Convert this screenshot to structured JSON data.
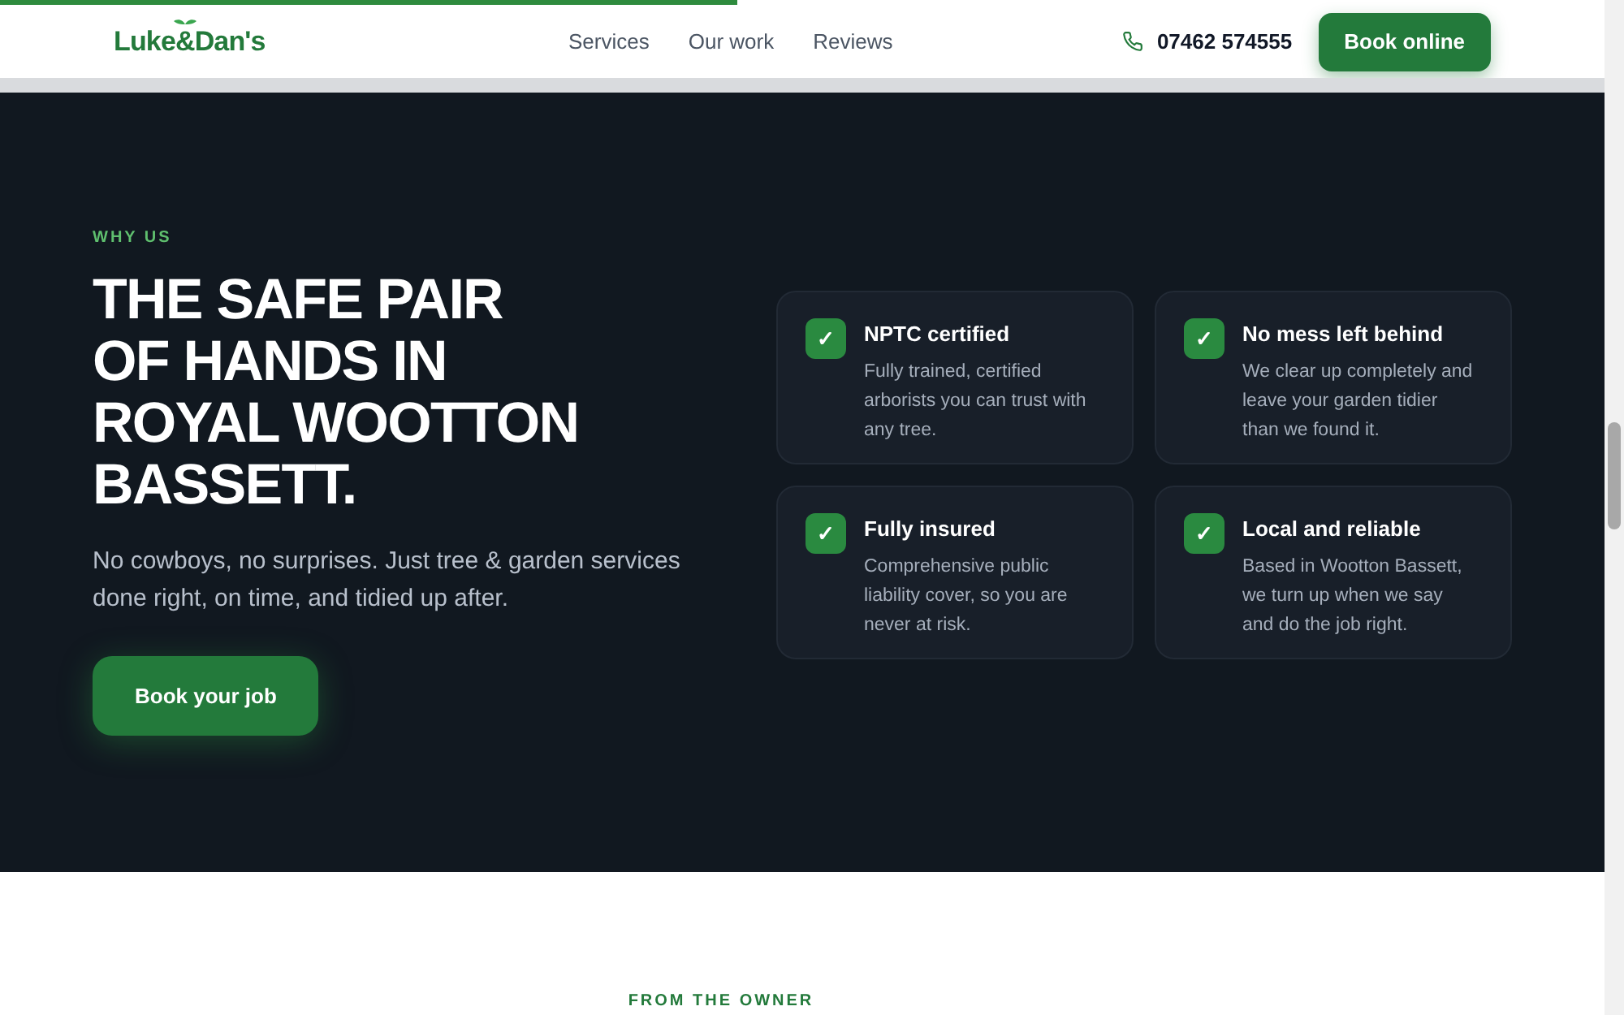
{
  "progress": {
    "level": 0.46
  },
  "header": {
    "logo": "Luke&Dan's",
    "nav": [
      {
        "label": "Services"
      },
      {
        "label": "Our work"
      },
      {
        "label": "Reviews"
      }
    ],
    "phone": "07462 574555",
    "cta": "Book online"
  },
  "hero": {
    "eyebrow": "WHY US",
    "title_lines": [
      "THE SAFE PAIR",
      "OF HANDS IN",
      "ROYAL WOOTTON",
      "BASSETT."
    ],
    "lead": "No cowboys, no surprises. Just tree & garden services done right, on time, and tidied up after.",
    "cta": "Book your job",
    "features": [
      {
        "icon": "✓",
        "title": "NPTC certified",
        "text": "Fully trained, certified arborists you can trust with any tree."
      },
      {
        "icon": "✓",
        "title": "No mess left behind",
        "text": "We clear up completely and leave your garden tidier than we found it."
      },
      {
        "icon": "✓",
        "title": "Fully insured",
        "text": "Comprehensive public liability cover, so you are never at risk."
      },
      {
        "icon": "✓",
        "title": "Local and reliable",
        "text": "Based in Wootton Bassett, we turn up when we say and do the job right."
      }
    ]
  },
  "next_section": {
    "eyebrow": "FROM THE OWNER"
  }
}
